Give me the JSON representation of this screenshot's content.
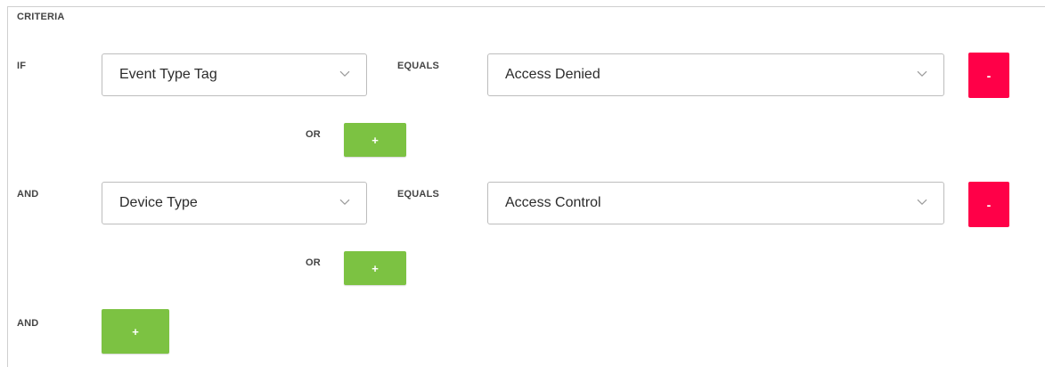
{
  "criteria": {
    "title": "CRITERIA",
    "rows": [
      {
        "connector": "IF",
        "field": "Event Type Tag",
        "operator": "EQUALS",
        "value": "Access Denied",
        "remove_label": "-",
        "or_label": "OR",
        "or_add_label": "+"
      },
      {
        "connector": "AND",
        "field": "Device Type",
        "operator": "EQUALS",
        "value": "Access Control",
        "remove_label": "-",
        "or_label": "OR",
        "or_add_label": "+"
      }
    ],
    "and_label": "AND",
    "and_add_label": "+"
  },
  "colors": {
    "remove_button": "#ff0048",
    "add_button": "#7cc242",
    "border": "#bdbdbd"
  },
  "icons": {
    "dropdown": "chevron-down-icon"
  }
}
